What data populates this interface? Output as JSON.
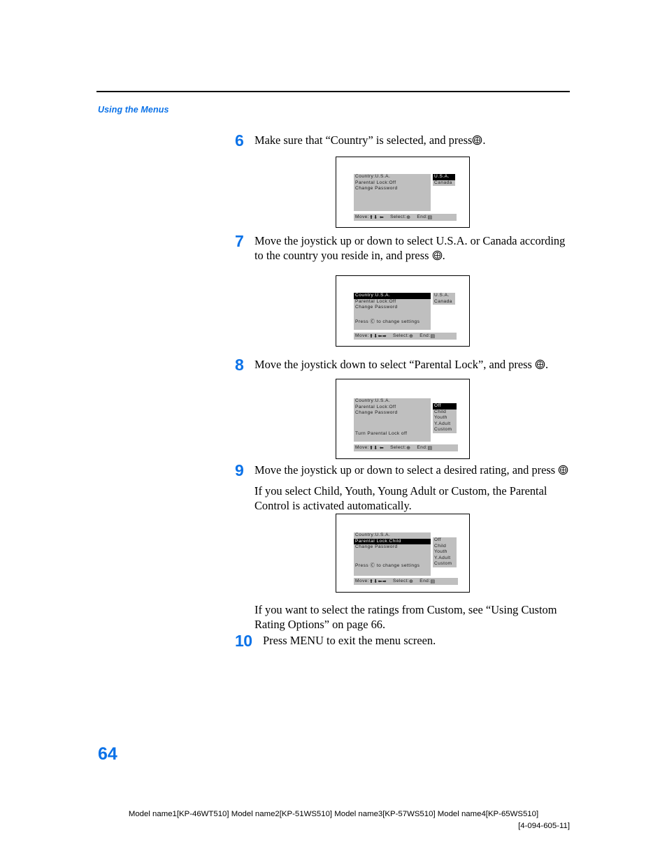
{
  "header": {
    "running_head": "Using the Menus"
  },
  "accent_color": "#0b72e8",
  "steps": [
    {
      "number": "6",
      "text_before": "Make sure that “Country” is selected, and press",
      "icon": "joystick-press-icon",
      "text_after": "."
    },
    {
      "number": "7",
      "text_before": "Move the joystick up or down to select U.S.A. or Canada according to the country you reside in, and press",
      "icon": "joystick-press-icon",
      "text_after": "."
    },
    {
      "number": "8",
      "text_before": "Move the joystick down to select “Parental Lock”, and press",
      "icon": "joystick-press-icon",
      "text_after": "."
    },
    {
      "number": "9",
      "text_before": "Move the joystick up or down to select a desired rating, and press",
      "icon": "joystick-press-icon",
      "text_after": ".",
      "note": "If you select Child, Youth, Young Adult or Custom, the Parental Control is activated automatically."
    },
    {
      "number": "10",
      "text_before": "Press MENU to exit the menu screen.",
      "icon": "",
      "text_after": ""
    }
  ],
  "custom_note": "If you want to select the ratings from Custom, see “Using Custom Rating Options” on page 66.",
  "figures": [
    {
      "id": "figure-step6",
      "menu_lines": [
        {
          "text": "Country:U.S.A.",
          "selected": false
        },
        {
          "text": "Parental Lock:Off",
          "selected": false
        },
        {
          "text": "Change Password",
          "selected": false
        }
      ],
      "hint": "",
      "side_lines": [
        {
          "text": "U.S.A.",
          "selected": true
        },
        {
          "text": "Canada",
          "selected": false
        }
      ],
      "footer": {
        "move_label": "Move:",
        "move_glyph": "⬆⬇  ⬅",
        "select_label": "Select:",
        "select_glyph": "⊕",
        "end_label": "End:",
        "end_glyph": "▤"
      }
    },
    {
      "id": "figure-step7",
      "menu_lines": [
        {
          "text": "Country:U.S.A.",
          "selected": true
        },
        {
          "text": "Parental Lock:Off",
          "selected": false
        },
        {
          "text": "Change Password",
          "selected": false
        }
      ],
      "hint": "Press Ⓒ to change settings",
      "side_lines": [
        {
          "text": "U.S.A.",
          "selected": false
        },
        {
          "text": "Canada",
          "selected": false
        }
      ],
      "footer": {
        "move_label": "Move:",
        "move_glyph": "⬆⬇⬅➡",
        "select_label": "Select:",
        "select_glyph": "⊕",
        "end_label": "End:",
        "end_glyph": "▤"
      }
    },
    {
      "id": "figure-step8",
      "menu_lines": [
        {
          "text": "Country:U.S.A.",
          "selected": false
        },
        {
          "text": "Parental Lock:Off",
          "selected": false
        },
        {
          "text": "Change Password",
          "selected": false
        }
      ],
      "hint": "Turn Parental Lock off",
      "side_lines": [
        {
          "text": "Off",
          "selected": true
        },
        {
          "text": "Child",
          "selected": false
        },
        {
          "text": "Youth",
          "selected": false
        },
        {
          "text": "Y.Adult",
          "selected": false
        },
        {
          "text": "Custom",
          "selected": false
        }
      ],
      "footer": {
        "move_label": "Move:",
        "move_glyph": "⬆⬇  ⬅",
        "select_label": "Select:",
        "select_glyph": "⊕",
        "end_label": "End:",
        "end_glyph": "▤"
      }
    },
    {
      "id": "figure-step9",
      "menu_lines": [
        {
          "text": "Country:U.S.A.",
          "selected": false
        },
        {
          "text": "Parental Lock:Child",
          "selected": true
        },
        {
          "text": "Change Password",
          "selected": false
        }
      ],
      "hint": "Press Ⓒ to change settings",
      "side_lines": [
        {
          "text": "Off",
          "selected": false
        },
        {
          "text": "Child",
          "selected": false
        },
        {
          "text": "Youth",
          "selected": false
        },
        {
          "text": "Y.Adult",
          "selected": false
        },
        {
          "text": "Custom",
          "selected": false
        }
      ],
      "footer": {
        "move_label": "Move:",
        "move_glyph": "⬆⬇⬅➡",
        "select_label": "Select:",
        "select_glyph": "⊕",
        "end_label": "End:",
        "end_glyph": "▤"
      }
    }
  ],
  "page_number": "64",
  "footer": {
    "models": "Model name1[KP-46WT510] Model name2[KP-51WS510] Model name3[KP-57WS510] Model name4[KP-65WS510]",
    "part_number": "[4-094-605-11]"
  }
}
